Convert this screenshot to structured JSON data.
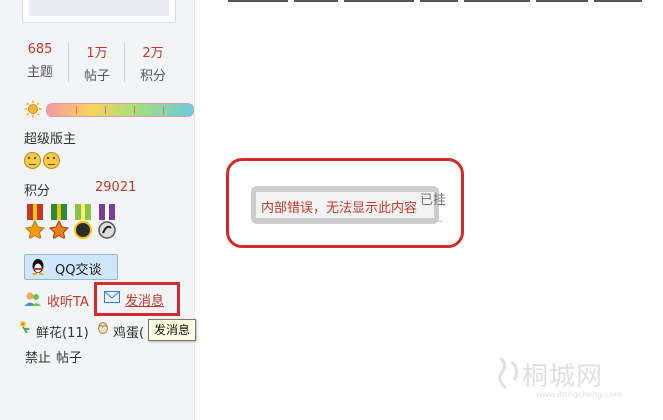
{
  "sidebar": {
    "stats": [
      {
        "value": "685",
        "label": "主题"
      },
      {
        "value": "1万",
        "label": "帖子"
      },
      {
        "value": "2万",
        "label": "积分"
      }
    ],
    "rank_title": "超级版主",
    "points_label": "积分",
    "points_value": "29021",
    "qq_button_label": "QQ交谈",
    "follow_label": "收听TA",
    "message_label": "发消息",
    "flower_label": "鲜花(11)",
    "egg_label": "鸡蛋(",
    "ban_label": "禁止",
    "posts_label": "帖子"
  },
  "tooltip": {
    "text": "发消息"
  },
  "content": {
    "error_message": "内部错误，无法显示此内容",
    "error_ghost_text": "已挂"
  },
  "watermark": {
    "name": "桐城网",
    "url": "www.itongcheng.com"
  },
  "colors": {
    "accent_red": "#c0392b",
    "highlight_red": "#d42a2a",
    "sidebar_bg": "#f2f4f6",
    "qq_button_bg": "#cfe6fb"
  }
}
